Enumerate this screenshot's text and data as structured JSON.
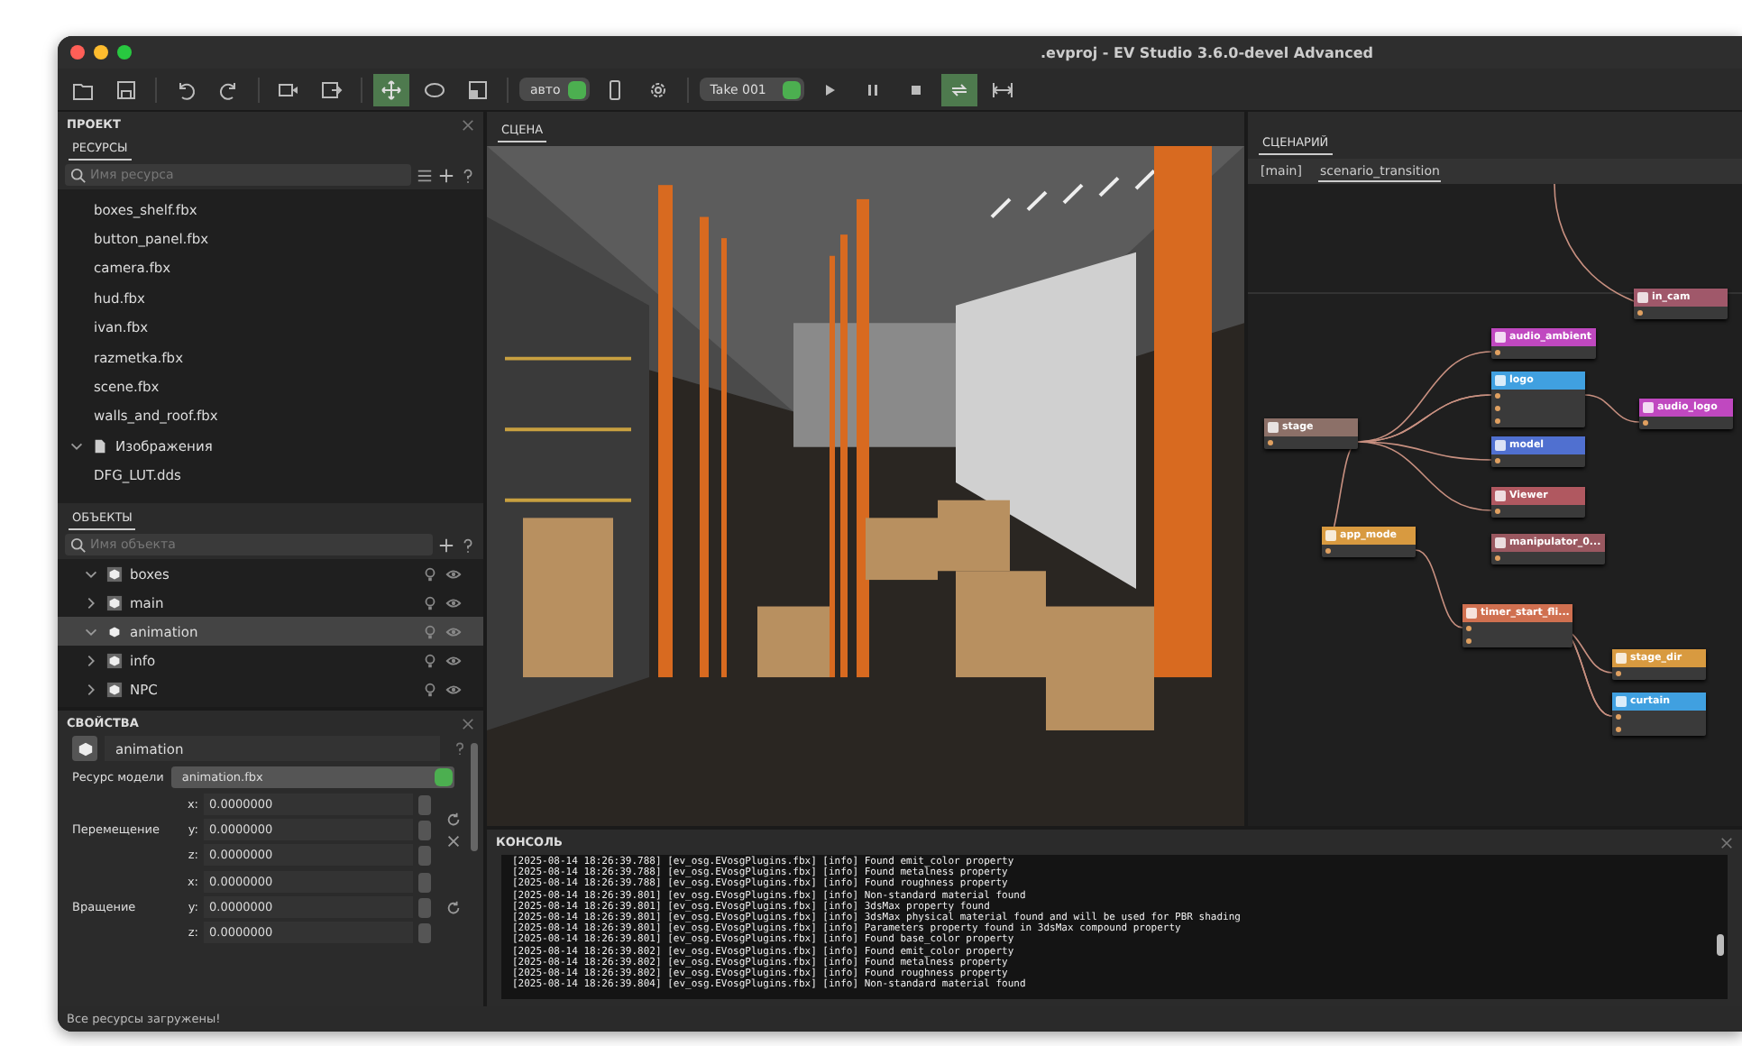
{
  "window": {
    "title": ".evproj - EV Studio 3.6.0-devel Advanced"
  },
  "toolbar": {
    "transform_tools": [
      {
        "selected": true
      },
      {
        "selected": false
      },
      {
        "selected": false
      }
    ],
    "mode_dropdown": "авто",
    "take_dropdown": "Take 001",
    "loop_on": true
  },
  "project_panel": {
    "title": "ПРОЕКТ",
    "resources_tab": "РЕСУРСЫ",
    "resource_search": {
      "placeholder": "Имя ресурса"
    },
    "resources": [
      {
        "kind": "file",
        "name": "boxes_shelf.fbx"
      },
      {
        "kind": "file",
        "name": "button_panel.fbx"
      },
      {
        "kind": "file",
        "name": "camera.fbx"
      },
      {
        "kind": "file",
        "name": "hud.fbx"
      },
      {
        "kind": "file",
        "name": "ivan.fbx"
      },
      {
        "kind": "file",
        "name": "razmetka.fbx"
      },
      {
        "kind": "file",
        "name": "scene.fbx"
      },
      {
        "kind": "file",
        "name": "walls_and_roof.fbx"
      },
      {
        "kind": "folder",
        "name": "Изображения",
        "expanded": true
      },
      {
        "kind": "file",
        "name": "DFG_LUT.dds"
      }
    ],
    "objects_tab": "ОБЪЕКТЫ",
    "object_search": {
      "placeholder": "Имя объекта"
    },
    "objects": [
      {
        "name": "boxes",
        "expanded": true,
        "selected": false
      },
      {
        "name": "main",
        "expanded": false,
        "selected": false
      },
      {
        "name": "animation",
        "expanded": true,
        "selected": true
      },
      {
        "name": "info",
        "expanded": false,
        "selected": false
      },
      {
        "name": "NPC",
        "expanded": false,
        "selected": false
      }
    ]
  },
  "properties_panel": {
    "title": "СВОЙСТВА",
    "object_name": "animation",
    "model_resource_label": "Ресурс модели",
    "model_resource": "animation.fbx",
    "groups": [
      {
        "label": "Перемещение",
        "fields": [
          {
            "axis": "x:",
            "value": "0.0000000"
          },
          {
            "axis": "y:",
            "value": "0.0000000"
          },
          {
            "axis": "z:",
            "value": "0.0000000"
          }
        ]
      },
      {
        "label": "Вращение",
        "fields": [
          {
            "axis": "x:",
            "value": "0.0000000"
          },
          {
            "axis": "y:",
            "value": "0.0000000"
          },
          {
            "axis": "z:",
            "value": "0.0000000"
          }
        ]
      }
    ]
  },
  "scene_panel": {
    "tab": "СЦЕНА"
  },
  "scenario_panel": {
    "tab": "СЦЕНАРИЙ",
    "graph_tabs": [
      {
        "label": "[main]",
        "selected": false
      },
      {
        "label": "scenario_transition",
        "selected": true
      }
    ],
    "nodes": [
      {
        "title": "in_cam",
        "color": "#a0586a"
      },
      {
        "title": "audio_ambient",
        "color": "#c048c0"
      },
      {
        "title": "logo",
        "color": "#40a0e0"
      },
      {
        "title": "audio_logo",
        "color": "#c048c0"
      },
      {
        "title": "stage",
        "color": "#8c7068"
      },
      {
        "title": "model",
        "color": "#5070d0"
      },
      {
        "title": "Viewer",
        "color": "#b05860"
      },
      {
        "title": "manipulator_0...",
        "color": "#9a5860"
      },
      {
        "title": "app_mode",
        "color": "#d89a40"
      },
      {
        "title": "timer_start_fli...",
        "color": "#d07050"
      },
      {
        "title": "stage_dir",
        "color": "#d89a40"
      },
      {
        "title": "curtain",
        "color": "#40a0e0"
      }
    ]
  },
  "console": {
    "title": "КОНСОЛЬ",
    "lines": [
      "[2025-08-14 18:26:39.788] [ev_osg.EVosgPlugins.fbx] [info] Found emit_color property",
      "[2025-08-14 18:26:39.788] [ev_osg.EVosgPlugins.fbx] [info] Found metalness property",
      "[2025-08-14 18:26:39.788] [ev_osg.EVosgPlugins.fbx] [info] Found roughness property",
      "[2025-08-14 18:26:39.801] [ev_osg.EVosgPlugins.fbx] [info] Non-standard material found",
      "[2025-08-14 18:26:39.801] [ev_osg.EVosgPlugins.fbx] [info] 3dsMax property found",
      "[2025-08-14 18:26:39.801] [ev_osg.EVosgPlugins.fbx] [info] 3dsMax physical material found and will be used for PBR shading",
      "[2025-08-14 18:26:39.801] [ev_osg.EVosgPlugins.fbx] [info] Parameters property found in 3dsMax compound property",
      "[2025-08-14 18:26:39.801] [ev_osg.EVosgPlugins.fbx] [info] Found base_color property",
      "[2025-08-14 18:26:39.802] [ev_osg.EVosgPlugins.fbx] [info] Found emit_color property",
      "[2025-08-14 18:26:39.802] [ev_osg.EVosgPlugins.fbx] [info] Found metalness property",
      "[2025-08-14 18:26:39.802] [ev_osg.EVosgPlugins.fbx] [info] Found roughness property",
      "[2025-08-14 18:26:39.804] [ev_osg.EVosgPlugins.fbx] [info] Non-standard material found"
    ]
  },
  "status_bar": {
    "text": "Все ресурсы загружены!"
  }
}
